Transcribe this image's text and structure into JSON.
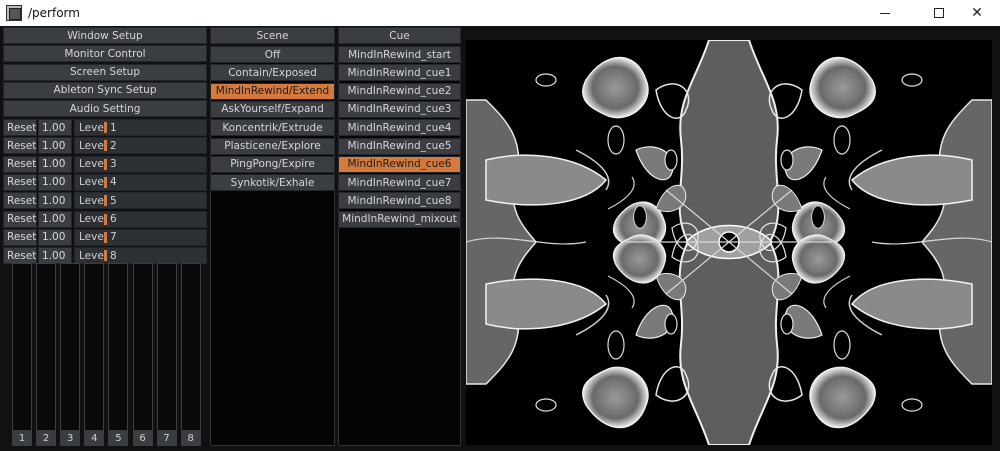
{
  "window": {
    "title": "/perform"
  },
  "left_menu": [
    "Window Setup",
    "Monitor Control",
    "Screen Setup",
    "Ableton Sync Setup",
    "Audio Setting"
  ],
  "audio_rows": [
    {
      "reset": "Reset",
      "value": "1.00",
      "label": "Level 1"
    },
    {
      "reset": "Reset",
      "value": "1.00",
      "label": "Level 2"
    },
    {
      "reset": "Reset",
      "value": "1.00",
      "label": "Level 3"
    },
    {
      "reset": "Reset",
      "value": "1.00",
      "label": "Level 4"
    },
    {
      "reset": "Reset",
      "value": "1.00",
      "label": "Level 5"
    },
    {
      "reset": "Reset",
      "value": "1.00",
      "label": "Level 6"
    },
    {
      "reset": "Reset",
      "value": "1.00",
      "label": "Level 7"
    },
    {
      "reset": "Reset",
      "value": "1.00",
      "label": "Level 8"
    }
  ],
  "meters": [
    "1",
    "2",
    "3",
    "4",
    "5",
    "6",
    "7",
    "8"
  ],
  "scene": {
    "header": "Scene",
    "items": [
      "Off",
      "Contain/Exposed",
      "MindInRewind/Extend",
      "AskYourself/Expand",
      "Koncentrik/Extrude",
      "Plasticene/Explore",
      "PingPong/Expire",
      "Synkotik/Exhale"
    ],
    "selected_index": 2
  },
  "cue": {
    "header": "Cue",
    "items": [
      "MindInRewind_start",
      "MindInRewind_cue1",
      "MindInRewind_cue2",
      "MindInRewind_cue3",
      "MindInRewind_cue4",
      "MindInRewind_cue5",
      "MindInRewind_cue6",
      "MindInRewind_cue7",
      "MindInRewind_cue8",
      "MindInRewind_mixout"
    ],
    "selected_index": 6
  },
  "colors": {
    "accent": "#d37a3c",
    "button": "#3a3d42",
    "background": "#111111"
  }
}
